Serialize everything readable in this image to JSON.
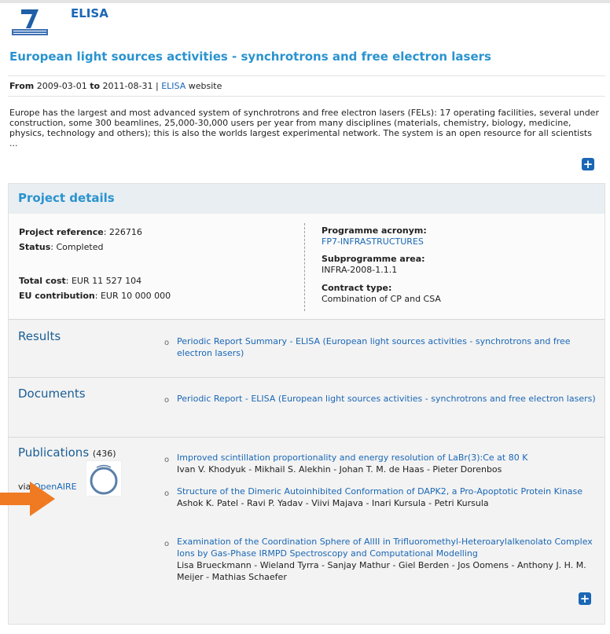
{
  "header": {
    "acronym": "ELISA",
    "title": "European light sources activities - synchrotrons and free electron lasers"
  },
  "dates": {
    "from_label": "From",
    "from": "2009-03-01",
    "to_label": "to",
    "to": "2011-08-31",
    "separator": "|",
    "website_link": "ELISA",
    "website_suffix": "website"
  },
  "summary": "Europe has the largest and most advanced system of synchrotrons and free electron lasers (FELs): 17 operating facilities, several under construction, some 300 beamlines, 25,000-30,000 users per year from many disciplines (materials, chemistry, biology, medicine, physics, technology and others); this is also the worlds largest experimental network. The system is an open resource for all scientists ...",
  "project_details": {
    "title": "Project details",
    "reference_label": "Project reference",
    "reference": "226716",
    "status_label": "Status",
    "status": "Completed",
    "total_cost_label": "Total cost",
    "total_cost": "EUR 11 527 104",
    "eu_contribution_label": "EU contribution",
    "eu_contribution": "EUR 10 000 000",
    "programme_label": "Programme acronym:",
    "programme": "FP7-INFRASTRUCTURES",
    "subprogramme_label": "Subprogramme area:",
    "subprogramme": "INFRA-2008-1.1.1",
    "contract_label": "Contract type:",
    "contract": "Combination of CP and CSA"
  },
  "results": {
    "title": "Results",
    "items": [
      "Periodic Report Summary - ELISA (European light sources activities - synchrotrons and free electron lasers)"
    ]
  },
  "documents": {
    "title": "Documents",
    "items": [
      "Periodic Report - ELISA (European light sources activities - synchrotrons and free electron lasers)"
    ]
  },
  "publications": {
    "title": "Publications",
    "count": "(436)",
    "via_label": "via",
    "via_link": "OpenAIRE",
    "items": [
      {
        "title": "Improved scintillation proportionality and energy resolution of LaBr(3):Ce at 80 K",
        "authors": "Ivan V. Khodyuk - Mikhail S. Alekhin - Johan T. M. de Haas - Pieter Dorenbos"
      },
      {
        "title": "Structure of the Dimeric Autoinhibited Conformation of DAPK2, a Pro-Apoptotic Protein Kinase",
        "authors": "Ashok K. Patel - Ravi P. Yadav - Viivi Majava - Inari Kursula - Petri Kursula"
      },
      {
        "title": "Examination of the Coordination Sphere of AlIII in Trifluoromethyl-Heteroarylalkenolato Complex Ions by Gas-Phase IRMPD Spectroscopy and Computational Modelling",
        "authors": "Lisa Brueckmann - Wieland Tyrra - Sanjay Mathur - Giel Berden - Jos Oomens - Anthony J. H. M. Meijer - Mathias Schaefer"
      }
    ]
  },
  "colors": {
    "link": "#1a67b5",
    "title": "#2a93cf",
    "arrow": "#f07a22"
  },
  "icons": {
    "expand": "plus-icon",
    "bullet": "bullet-icon",
    "arrow": "arrow-right-icon"
  }
}
